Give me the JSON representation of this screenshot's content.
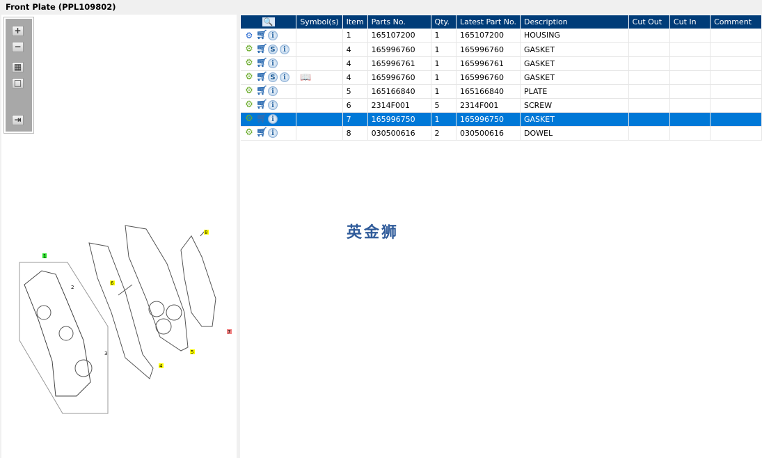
{
  "title": "Front Plate (PPL109802)",
  "toolbar": {
    "zoom_in": "+",
    "zoom_out": "−",
    "fit_all": "▦",
    "fit_one": "□",
    "export": "⇥"
  },
  "table": {
    "columns": [
      "Symbol(s)",
      "Item",
      "Parts No.",
      "Qty.",
      "Latest Part No.",
      "Description",
      "Cut Out",
      "Cut In",
      "Comment"
    ],
    "rows": [
      {
        "item": "1",
        "parts_no": "165107200",
        "qty": "1",
        "latest": "165107200",
        "desc": "HOUSING",
        "assembly": true,
        "s": false,
        "symbol": false
      },
      {
        "item": "4",
        "parts_no": "165996760",
        "qty": "1",
        "latest": "165996760",
        "desc": "GASKET",
        "assembly": false,
        "s": true,
        "symbol": false
      },
      {
        "item": "4",
        "parts_no": "165996761",
        "qty": "1",
        "latest": "165996761",
        "desc": "GASKET",
        "assembly": false,
        "s": false,
        "symbol": false
      },
      {
        "item": "4",
        "parts_no": "165996760",
        "qty": "1",
        "latest": "165996760",
        "desc": "GASKET",
        "assembly": false,
        "s": true,
        "symbol": true
      },
      {
        "item": "5",
        "parts_no": "165166840",
        "qty": "1",
        "latest": "165166840",
        "desc": "PLATE",
        "assembly": false,
        "s": false,
        "symbol": false
      },
      {
        "item": "6",
        "parts_no": "2314F001",
        "qty": "5",
        "latest": "2314F001",
        "desc": "SCREW",
        "assembly": false,
        "s": false,
        "symbol": false
      },
      {
        "item": "7",
        "parts_no": "165996750",
        "qty": "1",
        "latest": "165996750",
        "desc": "GASKET",
        "assembly": false,
        "s": false,
        "symbol": false,
        "selected": true
      },
      {
        "item": "8",
        "parts_no": "030500616",
        "qty": "2",
        "latest": "030500616",
        "desc": "DOWEL",
        "assembly": false,
        "s": false,
        "symbol": false
      }
    ]
  },
  "watermark": "英金狮",
  "callouts": [
    "1",
    "2",
    "3",
    "4",
    "5",
    "6",
    "7",
    "8"
  ]
}
